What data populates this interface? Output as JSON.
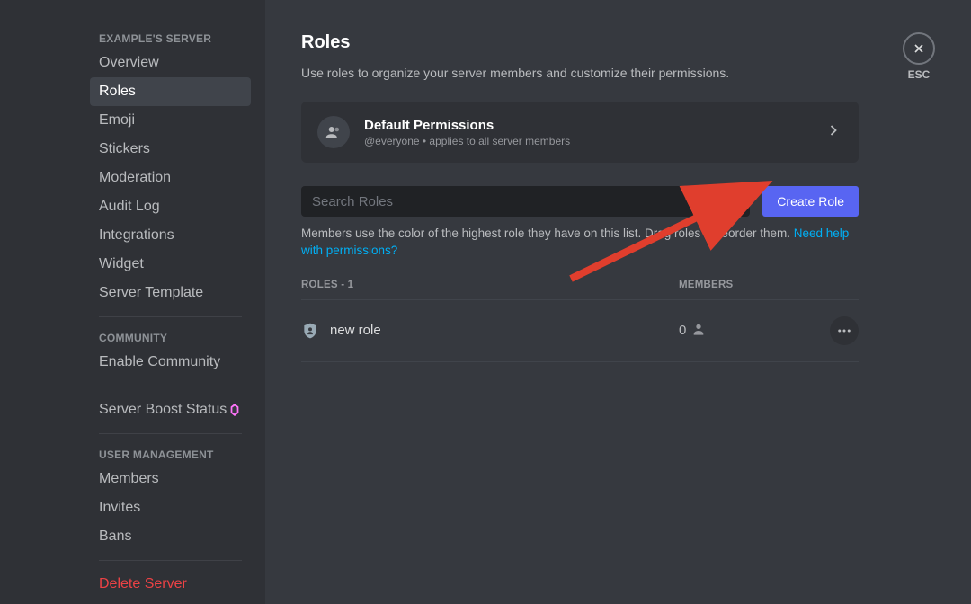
{
  "sidebar": {
    "sections": [
      {
        "header": "EXAMPLE'S SERVER",
        "items": [
          {
            "label": "Overview",
            "active": false
          },
          {
            "label": "Roles",
            "active": true
          },
          {
            "label": "Emoji",
            "active": false
          },
          {
            "label": "Stickers",
            "active": false
          },
          {
            "label": "Moderation",
            "active": false
          },
          {
            "label": "Audit Log",
            "active": false
          },
          {
            "label": "Integrations",
            "active": false
          },
          {
            "label": "Widget",
            "active": false
          },
          {
            "label": "Server Template",
            "active": false
          }
        ]
      },
      {
        "header": "COMMUNITY",
        "items": [
          {
            "label": "Enable Community",
            "active": false
          }
        ]
      },
      {
        "boost": {
          "label": "Server Boost Status"
        }
      },
      {
        "header": "USER MANAGEMENT",
        "items": [
          {
            "label": "Members",
            "active": false
          },
          {
            "label": "Invites",
            "active": false
          },
          {
            "label": "Bans",
            "active": false
          }
        ]
      }
    ],
    "delete_label": "Delete Server"
  },
  "close": {
    "esc_label": "ESC"
  },
  "page": {
    "title": "Roles",
    "description": "Use roles to organize your server members and customize their permissions.",
    "default_perm": {
      "title": "Default Permissions",
      "subtitle": "@everyone • applies to all server members"
    },
    "search_placeholder": "Search Roles",
    "create_label": "Create Role",
    "help_text_prefix": "Members use the color of the highest role they have on this list. Drag roles to reorder them. ",
    "help_link": "Need help with permissions?",
    "list": {
      "roles_header": "ROLES - 1",
      "members_header": "MEMBERS",
      "rows": [
        {
          "name": "new role",
          "member_count": "0"
        }
      ]
    }
  }
}
